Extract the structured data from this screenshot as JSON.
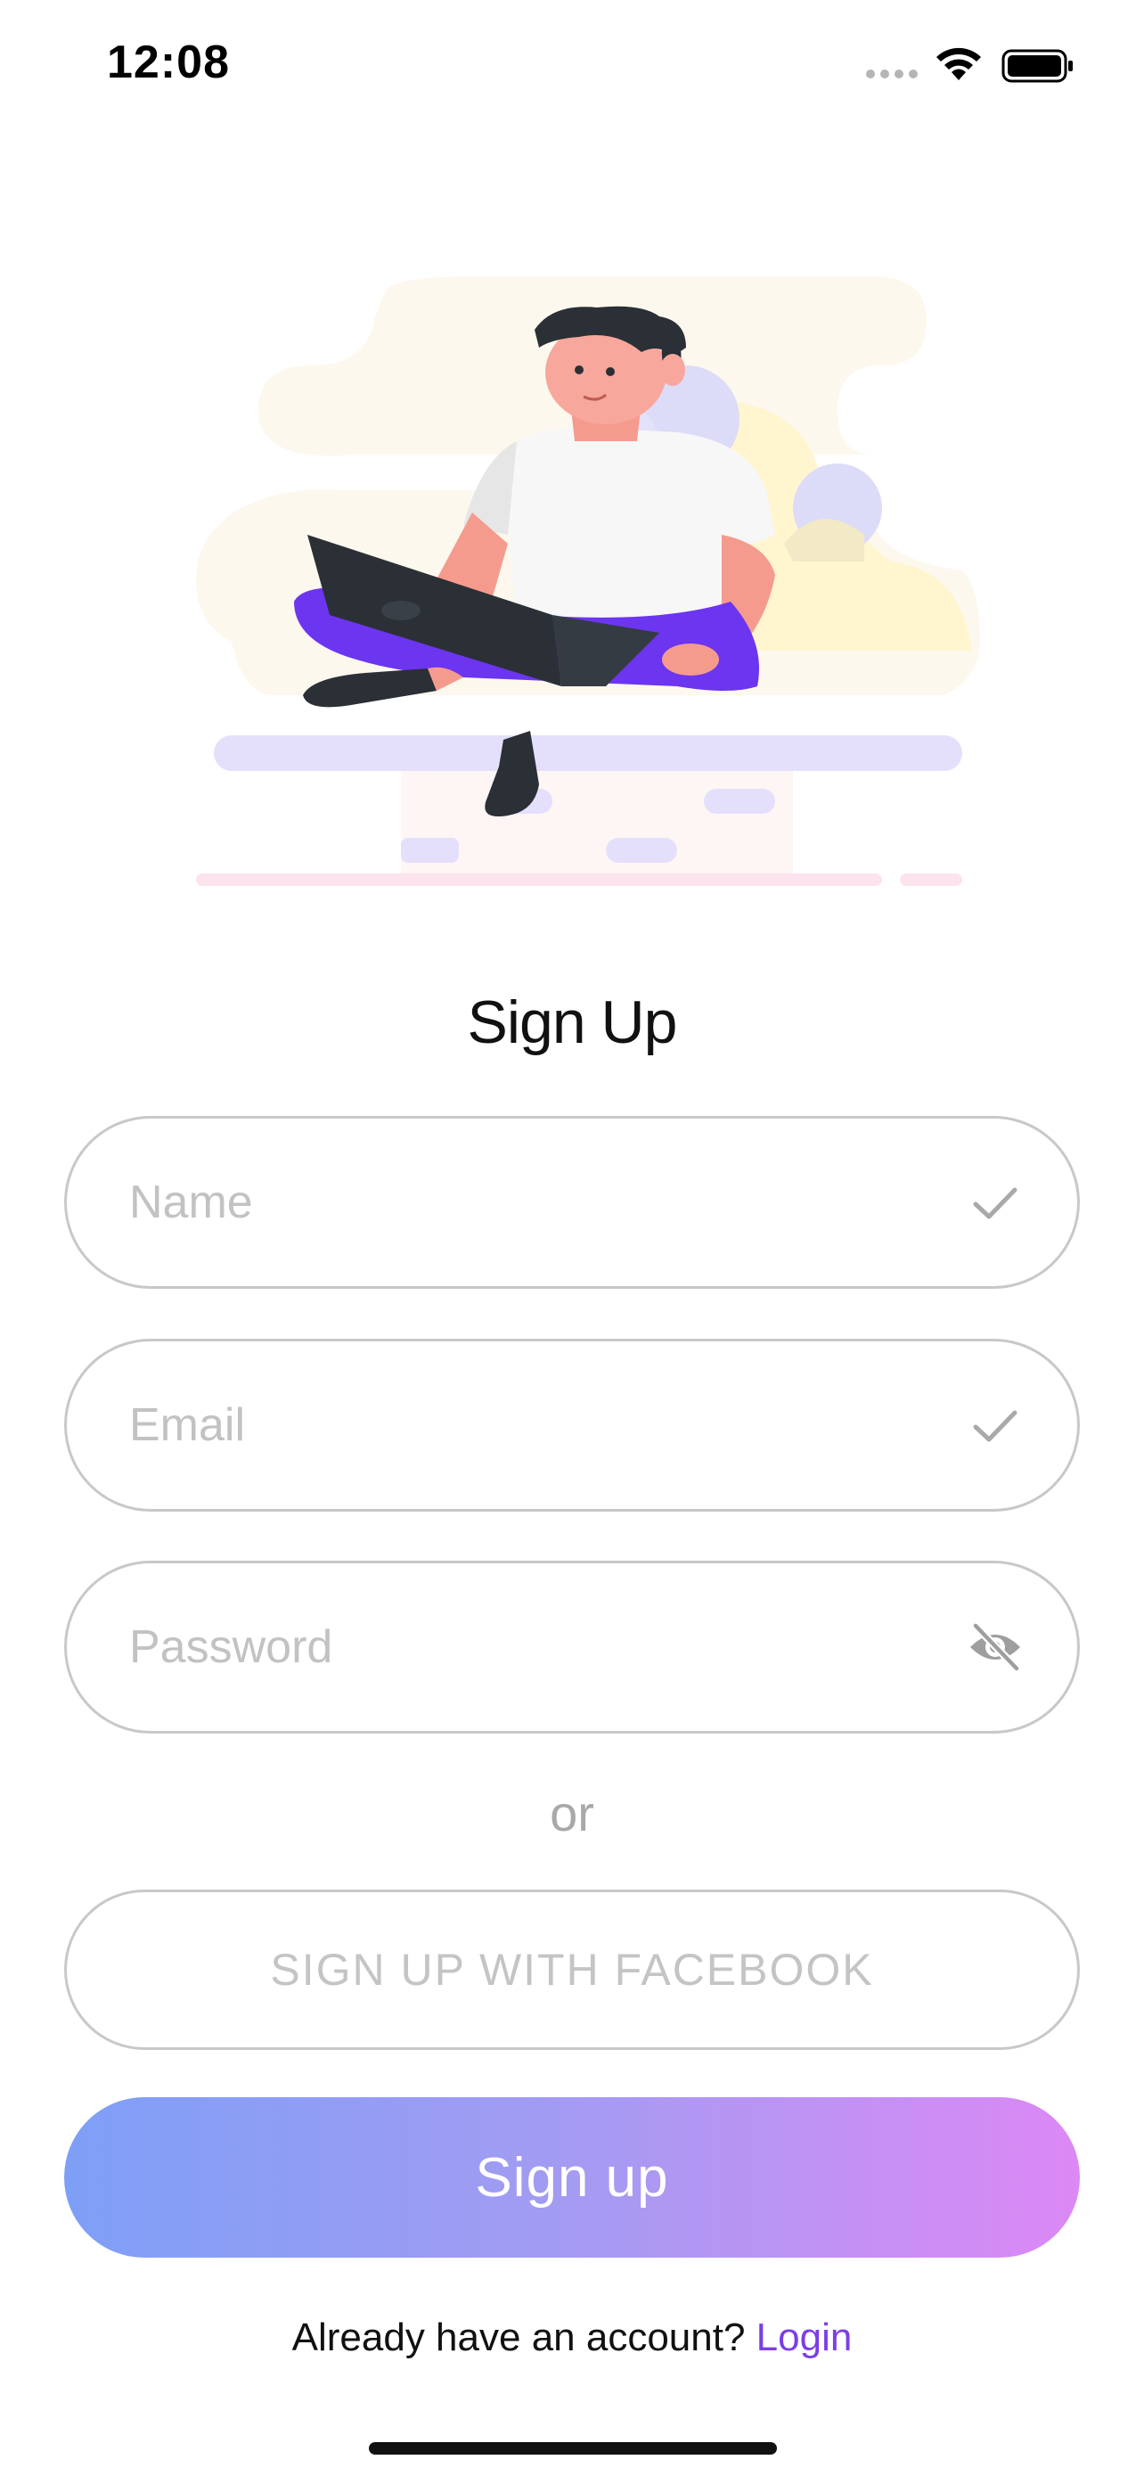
{
  "status_bar": {
    "time": "12:08"
  },
  "form": {
    "title": "Sign Up",
    "name_placeholder": "Name",
    "email_placeholder": "Email",
    "password_placeholder": "Password",
    "or_label": "or",
    "facebook_label": "SIGN UP WITH FACEBOOK",
    "signup_label": "Sign up"
  },
  "footer": {
    "prompt": "Already have an account?",
    "login_label": "Login"
  },
  "icons": {
    "name_status": "check-icon",
    "email_status": "check-icon",
    "password_toggle": "eye-off-icon"
  },
  "colors": {
    "accent": "#7b3fe4",
    "button_gradient_start": "#7e9ff6",
    "button_gradient_end": "#dc88f5",
    "field_border": "#c8c8c8",
    "placeholder": "#c2c2c2"
  }
}
